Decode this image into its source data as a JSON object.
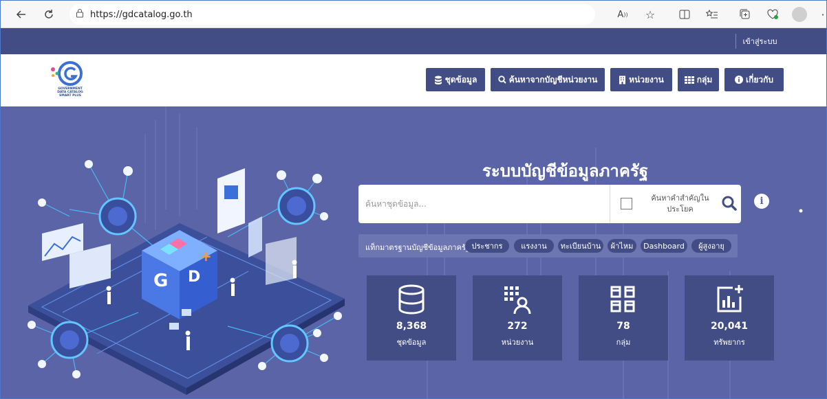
{
  "browser": {
    "url": "https://gdcatalog.go.th"
  },
  "topbar": {
    "login_label": "เข้าสู่ระบบ"
  },
  "logo": {
    "line1": "GOVERNMENT",
    "line2": "DATA CATALOG",
    "line3": "SMART PLUS"
  },
  "nav": {
    "items": [
      {
        "label": "ชุดข้อมูล",
        "icon": "database-icon"
      },
      {
        "label": "ค้นหาจากบัญชีหน่วยงาน",
        "icon": "search-icon"
      },
      {
        "label": "หน่วยงาน",
        "icon": "building-icon"
      },
      {
        "label": "กลุ่ม",
        "icon": "grid-icon"
      },
      {
        "label": "เกี่ยวกับ",
        "icon": "info-icon"
      }
    ]
  },
  "hero": {
    "title": "ระบบบัญชีข้อมูลภาครัฐ"
  },
  "search": {
    "placeholder": "ค้นหาชุดข้อมูล...",
    "checkbox_label": "ค้นหาคำสำคัญในประโยค"
  },
  "tags": {
    "label": "แท็กมาตรฐานบัญชีข้อมูลภาครัฐ :",
    "items": [
      "ประชากร",
      "แรงงาน",
      "ทะเบียนบ้าน",
      "ผ้าไหม",
      "Dashboard",
      "ผู้สูงอายุ"
    ]
  },
  "stats": [
    {
      "value": "8,368",
      "label": "ชุดข้อมูล",
      "icon": "database-icon"
    },
    {
      "value": "272",
      "label": "หน่วยงาน",
      "icon": "organization-icon"
    },
    {
      "value": "78",
      "label": "กลุ่ม",
      "icon": "group-icon"
    },
    {
      "value": "20,041",
      "label": "ทรัพยากร",
      "icon": "chart-resource-icon"
    }
  ],
  "colors": {
    "primary": "#434d85",
    "hero_bg": "#5a64a6",
    "tag_bar": "#6d76b1"
  }
}
